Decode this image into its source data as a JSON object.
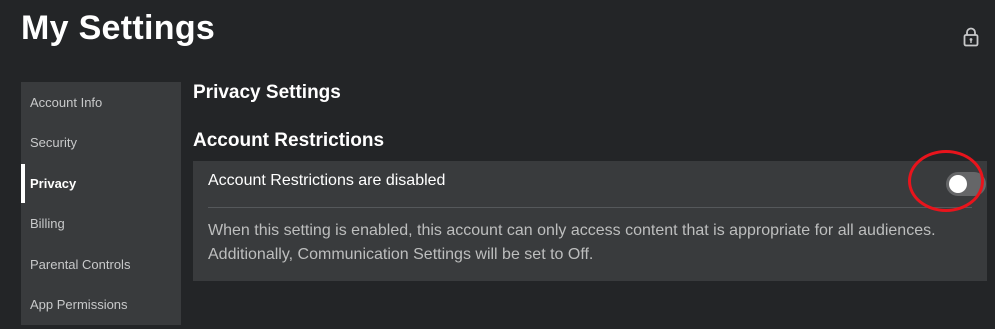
{
  "page": {
    "title": "My Settings",
    "lock_icon": "lock-icon"
  },
  "sidebar": {
    "items": [
      {
        "label": "Account Info",
        "active": false
      },
      {
        "label": "Security",
        "active": false
      },
      {
        "label": "Privacy",
        "active": true
      },
      {
        "label": "Billing",
        "active": false
      },
      {
        "label": "Parental Controls",
        "active": false
      },
      {
        "label": "App Permissions",
        "active": false
      }
    ]
  },
  "main": {
    "heading": "Privacy Settings",
    "section_heading": "Account Restrictions",
    "restriction_setting": {
      "label": "Account Restrictions are disabled",
      "toggle_state": "off",
      "description": "When this setting is enabled, this account can only access content that is appropriate for all audiences. Additionally, Communication Settings will be set to Off."
    }
  },
  "colors": {
    "background": "#232527",
    "panel": "#393b3d",
    "highlight_ring": "#e8141c",
    "toggle_off": "#656668"
  }
}
